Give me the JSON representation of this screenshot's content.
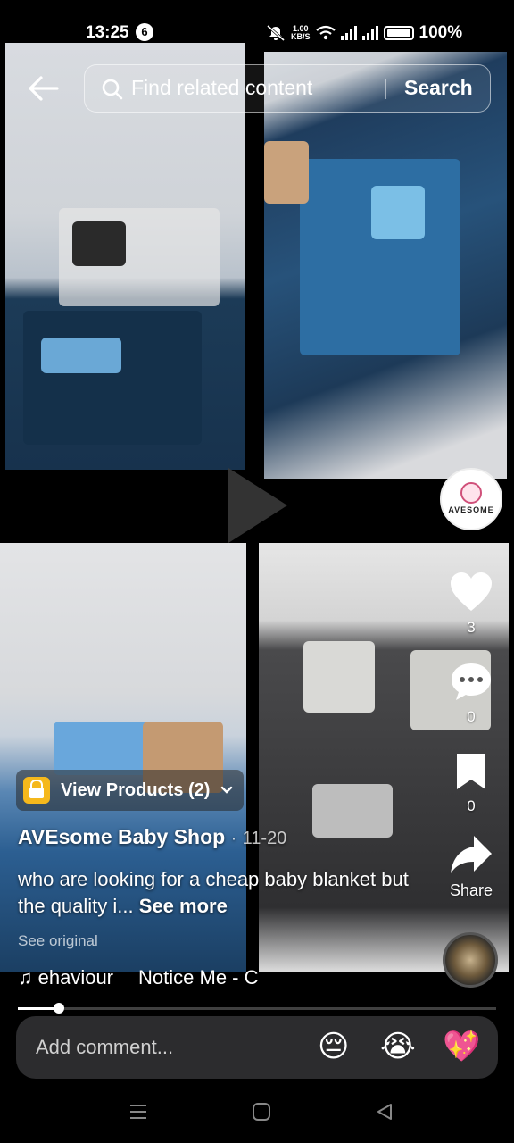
{
  "status_bar": {
    "time": "13:25",
    "notification_count": "6",
    "network_speed_value": "1.00",
    "network_speed_unit": "KB/S",
    "battery": "100%"
  },
  "search": {
    "placeholder": "Find related content",
    "button": "Search"
  },
  "video": {
    "progress_fraction": 0.085
  },
  "creator": {
    "avatar_text": "AVESOME"
  },
  "actions": {
    "likes": "3",
    "comments": "0",
    "saves": "0",
    "share_label": "Share"
  },
  "products": {
    "label": "View Products (2)"
  },
  "post": {
    "author": "AVEsome Baby Shop",
    "date_separator": "·",
    "date": "11-20",
    "caption": "who are looking for a cheap baby blanket but the quality i...",
    "see_more": "See more",
    "see_original": "See original"
  },
  "music": {
    "part1": "♫ ehaviour",
    "part2": "Notice Me - C"
  },
  "comment": {
    "placeholder": "Add comment...",
    "emojis": [
      "😔",
      "😭",
      "💖"
    ]
  },
  "colors": {
    "accent_bag": "#f5b81c",
    "comment_bg": "#2c2c2e"
  }
}
